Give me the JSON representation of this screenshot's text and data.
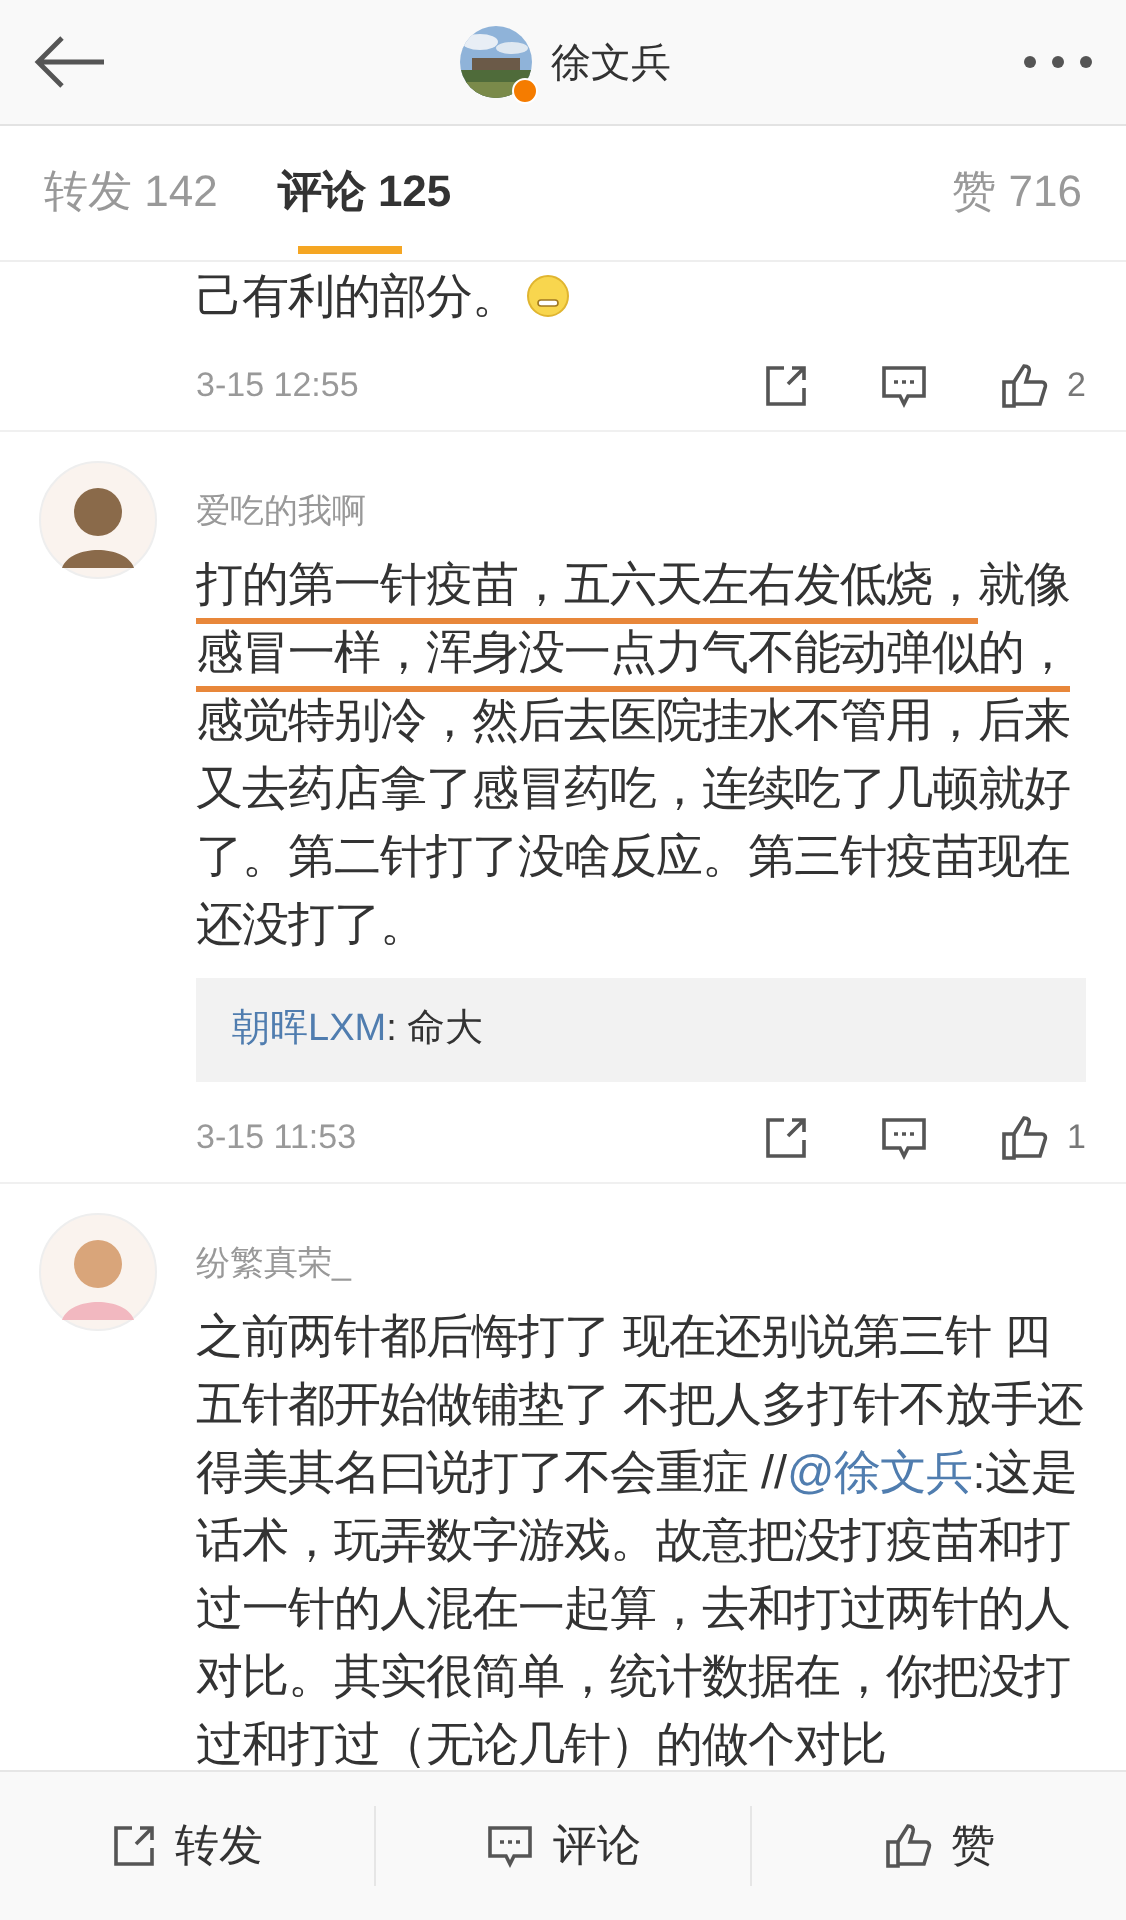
{
  "header": {
    "title": "徐文兵",
    "verified": true
  },
  "tabs": [
    {
      "label": "转发 142",
      "selected": false
    },
    {
      "label": "评论 125",
      "selected": true
    },
    {
      "label": "赞 716",
      "selected": false
    }
  ],
  "comments": [
    {
      "kind": "partial",
      "body": [
        {
          "text": "己有利的部分。",
          "kind": "plain"
        }
      ],
      "emoji": true,
      "time": "3-15 12:55",
      "likes": "2"
    },
    {
      "kind": "full",
      "user": "爱吃的我啊",
      "body": [
        {
          "text": "打的第一针疫苗，五六天左右发低烧，",
          "kind": "underline"
        },
        {
          "text": "就像",
          "kind": "plain"
        },
        {
          "text": "感冒一样，浑身没一点力气不能动弹似的，",
          "kind": "underline"
        },
        {
          "text": "感觉特别冷，然后去医院挂水不管用，后来又去药店拿了感冒药吃，连续吃了几顿就好了。第二针打了没啥反应。第三针疫苗现在还没打了。",
          "kind": "plain"
        }
      ],
      "reply": {
        "user": "朝晖LXM",
        "text": ": 命大"
      },
      "time": "3-15 11:53",
      "likes": "1"
    },
    {
      "kind": "full",
      "user": "纷繁真荣_",
      "body": [
        {
          "text": "之前两针都后悔打了 现在还别说第三针 四五针都开始做铺垫了 不把人多打针不放手还得美其名曰说打了不会重症 //",
          "kind": "plain"
        },
        {
          "text": "@徐文兵",
          "kind": "mention"
        },
        {
          "text": ":这是话术，玩弄数字游戏。故意把没打疫苗和打过一针的人混在一起算，去和打过两针的人对比。其实很简单，统计数据在，你把没打过和打过（无论几针）的做个对比",
          "kind": "plain"
        }
      ]
    }
  ],
  "toolbar": [
    {
      "kind": "share",
      "label": "转发"
    },
    {
      "kind": "comment",
      "label": "评论"
    },
    {
      "kind": "like",
      "label": "赞"
    }
  ]
}
